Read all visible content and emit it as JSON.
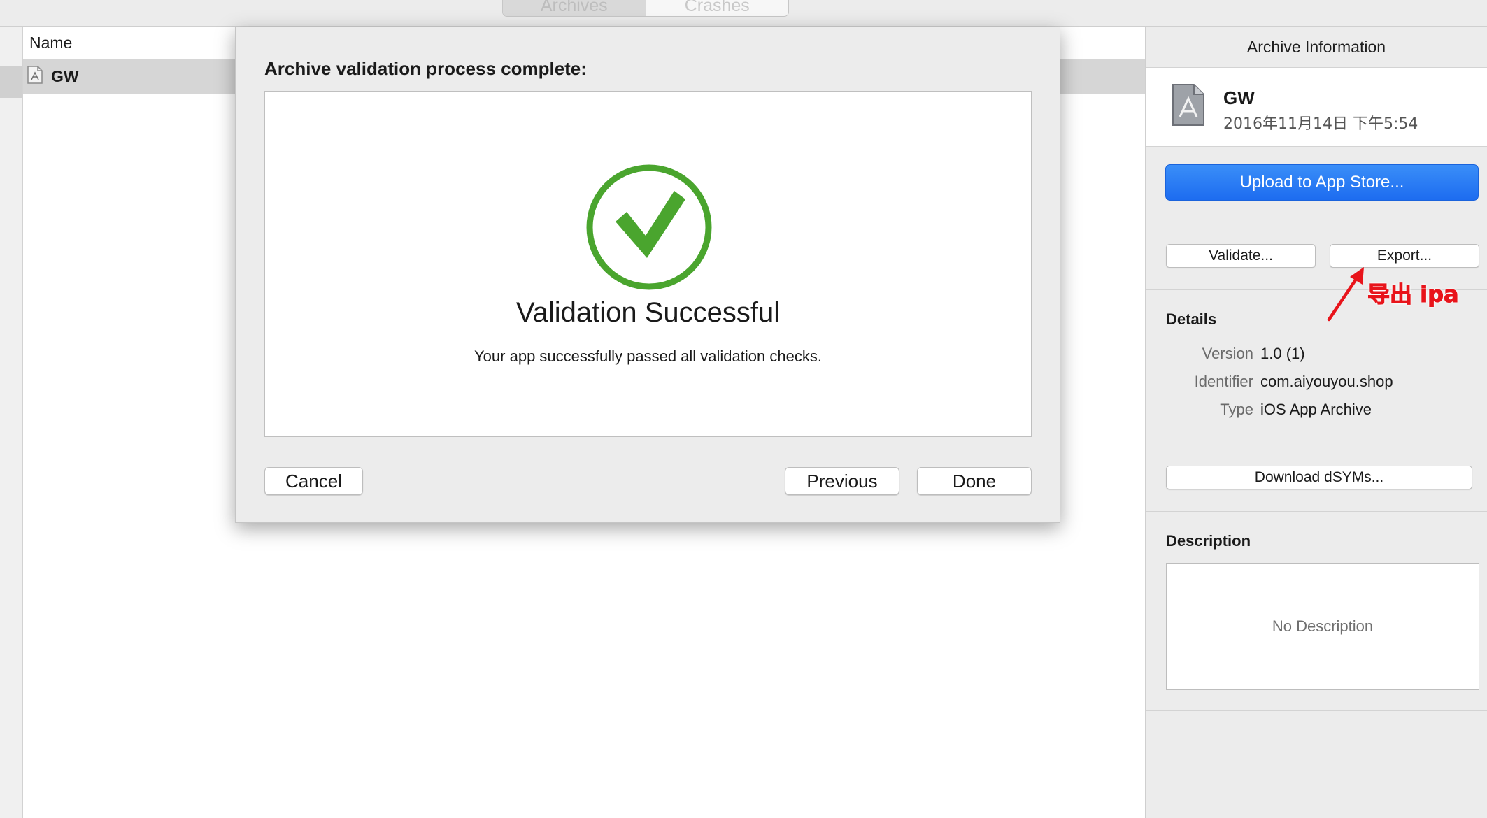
{
  "top_tabs": [
    "Archives",
    "Crashes"
  ],
  "table": {
    "column_name": "Name",
    "rows": [
      {
        "name": "GW"
      }
    ]
  },
  "inspector": {
    "title": "Archive Information",
    "app_name": "GW",
    "app_date": "2016年11月14日 下午5:54",
    "upload_label": "Upload to App Store...",
    "validate_label": "Validate...",
    "export_label": "Export...",
    "details_title": "Details",
    "details": [
      {
        "key": "Version",
        "value": "1.0 (1)"
      },
      {
        "key": "Identifier",
        "value": "com.aiyouyou.shop"
      },
      {
        "key": "Type",
        "value": "iOS App Archive"
      }
    ],
    "download_dsyms_label": "Download dSYMs...",
    "description_title": "Description",
    "description_placeholder": "No Description"
  },
  "annotation": {
    "text": "导出 ipa",
    "color": "#e8141b"
  },
  "sheet": {
    "title": "Archive validation process complete:",
    "status_title": "Validation Successful",
    "status_message": "Your app successfully passed all validation checks.",
    "success_color": "#4aa52e",
    "cancel_label": "Cancel",
    "previous_label": "Previous",
    "done_label": "Done"
  }
}
